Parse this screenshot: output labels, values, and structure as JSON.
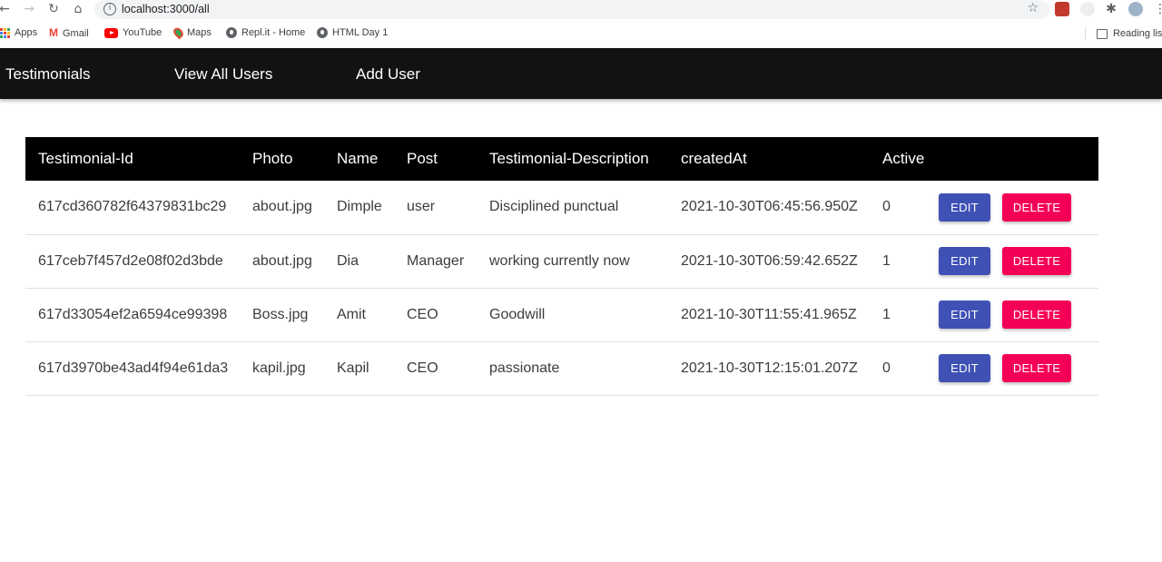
{
  "browser": {
    "url": "localhost:3000/all",
    "bookmarks": [
      {
        "label": "Apps",
        "icon": "apps-icon"
      },
      {
        "label": "Gmail",
        "icon": "gmail-icon"
      },
      {
        "label": "YouTube",
        "icon": "youtube-icon"
      },
      {
        "label": "Maps",
        "icon": "maps-icon"
      },
      {
        "label": "Repl.it - Home",
        "icon": "replit-icon"
      },
      {
        "label": "HTML Day 1",
        "icon": "globe-icon"
      }
    ],
    "reading_list": "Reading list"
  },
  "appbar": {
    "brand": "Testimonials",
    "links": [
      "View All Users",
      "Add User"
    ]
  },
  "table": {
    "headers": [
      "Testimonial-Id",
      "Photo",
      "Name",
      "Post",
      "Testimonial-Description",
      "createdAt",
      "Active"
    ],
    "rows": [
      {
        "id": "617cd360782f64379831bc29",
        "photo": "about.jpg",
        "name": "Dimple",
        "post": "user",
        "description": "Disciplined punctual",
        "createdAt": "2021-10-30T06:45:56.950Z",
        "active": "0"
      },
      {
        "id": "617ceb7f457d2e08f02d3bde",
        "photo": "about.jpg",
        "name": "Dia",
        "post": "Manager",
        "description": "working currently now",
        "createdAt": "2021-10-30T06:59:42.652Z",
        "active": "1"
      },
      {
        "id": "617d33054ef2a6594ce99398",
        "photo": "Boss.jpg",
        "name": "Amit",
        "post": "CEO",
        "description": "Goodwill",
        "createdAt": "2021-10-30T11:55:41.965Z",
        "active": "1"
      },
      {
        "id": "617d3970be43ad4f94e61da3",
        "photo": "kapil.jpg",
        "name": "Kapil",
        "post": "CEO",
        "description": "passionate",
        "createdAt": "2021-10-30T12:15:01.207Z",
        "active": "0"
      }
    ],
    "edit_label": "EDIT",
    "delete_label": "DELETE"
  },
  "colors": {
    "appbar_bg": "#121212",
    "table_header_bg": "#000000",
    "edit_button": "#3f51b5",
    "delete_button": "#f50057"
  }
}
